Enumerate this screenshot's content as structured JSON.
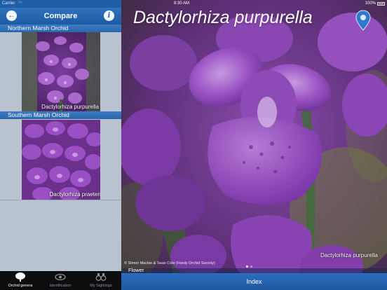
{
  "status_bar": {
    "carrier": "Carrier",
    "time": "8:30 AM",
    "battery": "100%"
  },
  "nav": {
    "title": "Compare",
    "back_icon": "back-arrow-icon",
    "info_icon": "info-icon"
  },
  "compare": {
    "items": [
      {
        "common_name": "Northern Marsh Orchid",
        "scientific_name": "Dactylorhiza purpurella"
      },
      {
        "common_name": "Southern Marsh Orchid",
        "scientific_name": "Dactylorhiza praetermissa"
      }
    ]
  },
  "tabs": [
    {
      "label": "Orchid genera",
      "icon": "tree-icon",
      "active": true
    },
    {
      "label": "Identification",
      "icon": "eye-icon",
      "active": false
    },
    {
      "label": "My Sightings",
      "icon": "binoculars-icon",
      "active": false
    }
  ],
  "detail": {
    "title": "Dactylorhiza purpurella",
    "photo_caption": "Dactylorhiza purpurella",
    "credit": "© Simon Mackie & Sean Cole (Hardy Orchid Society)",
    "page_dots": {
      "count": 2,
      "current": 1
    },
    "section_label": "Flower",
    "index_label": "Index",
    "map_pin_icon": "map-pin-icon"
  },
  "colors": {
    "nav_blue": "#2f73c0",
    "panel_grey": "#b9c3cf",
    "orchid_purple": "#7a3fa3"
  }
}
